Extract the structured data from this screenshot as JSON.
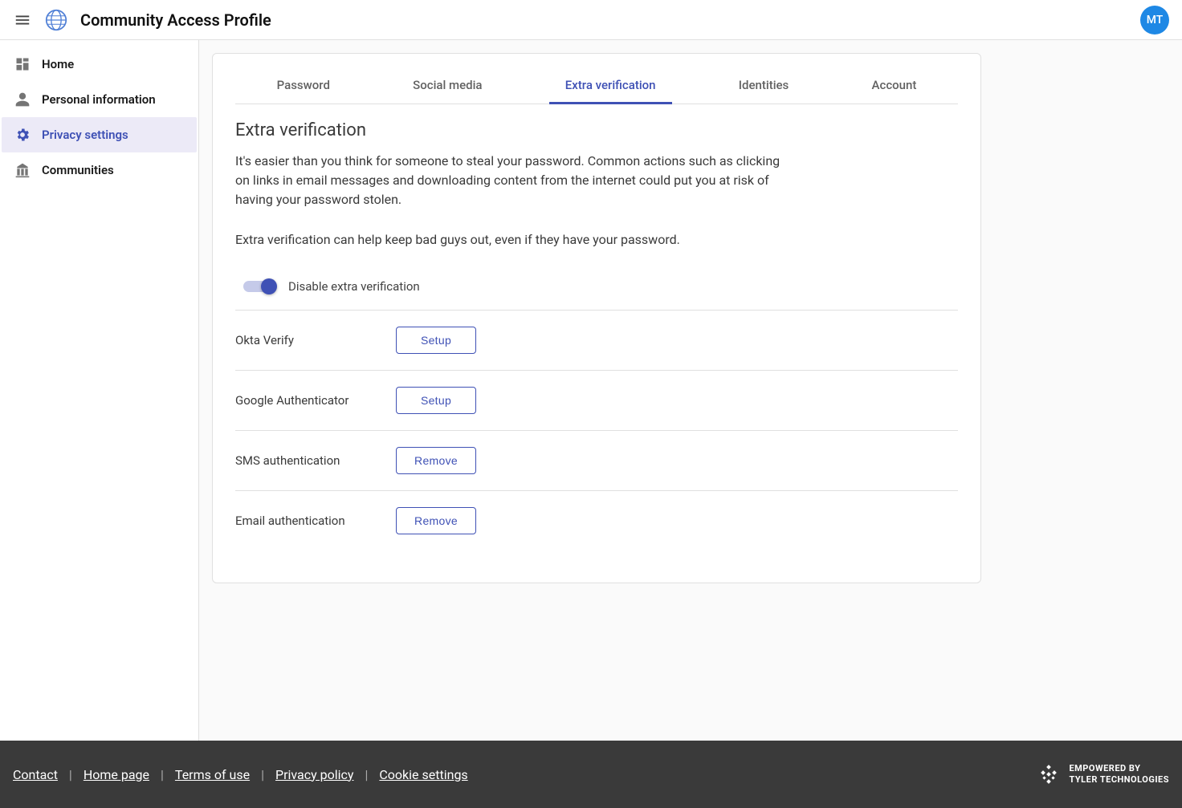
{
  "header": {
    "title": "Community Access Profile",
    "avatar_initials": "MT"
  },
  "sidebar": {
    "items": [
      {
        "label": "Home",
        "icon": "dashboard-icon",
        "active": false
      },
      {
        "label": "Personal information",
        "icon": "person-icon",
        "active": false
      },
      {
        "label": "Privacy settings",
        "icon": "gear-icon",
        "active": true
      },
      {
        "label": "Communities",
        "icon": "building-icon",
        "active": false
      }
    ]
  },
  "tabs": [
    {
      "label": "Password",
      "active": false
    },
    {
      "label": "Social media",
      "active": false
    },
    {
      "label": "Extra verification",
      "active": true
    },
    {
      "label": "Identities",
      "active": false
    },
    {
      "label": "Account",
      "active": false
    }
  ],
  "section": {
    "title": "Extra verification",
    "desc1": "It's easier than you think for someone to steal your password. Common actions such as clicking on links in email messages and downloading content from the internet could put you at risk of having your password stolen.",
    "desc2": "Extra verification can help keep bad guys out, even if they have your password."
  },
  "toggle": {
    "label": "Disable extra verification",
    "on": true
  },
  "factors": [
    {
      "name": "Okta Verify",
      "action": "Setup"
    },
    {
      "name": "Google Authenticator",
      "action": "Setup"
    },
    {
      "name": "SMS authentication",
      "action": "Remove"
    },
    {
      "name": "Email authentication",
      "action": "Remove"
    }
  ],
  "footer": {
    "links": [
      "Contact",
      "Home page",
      "Terms of use",
      "Privacy policy",
      "Cookie settings"
    ],
    "brand_line1": "EMPOWERED BY",
    "brand_line2": "TYLER TECHNOLOGIES"
  }
}
